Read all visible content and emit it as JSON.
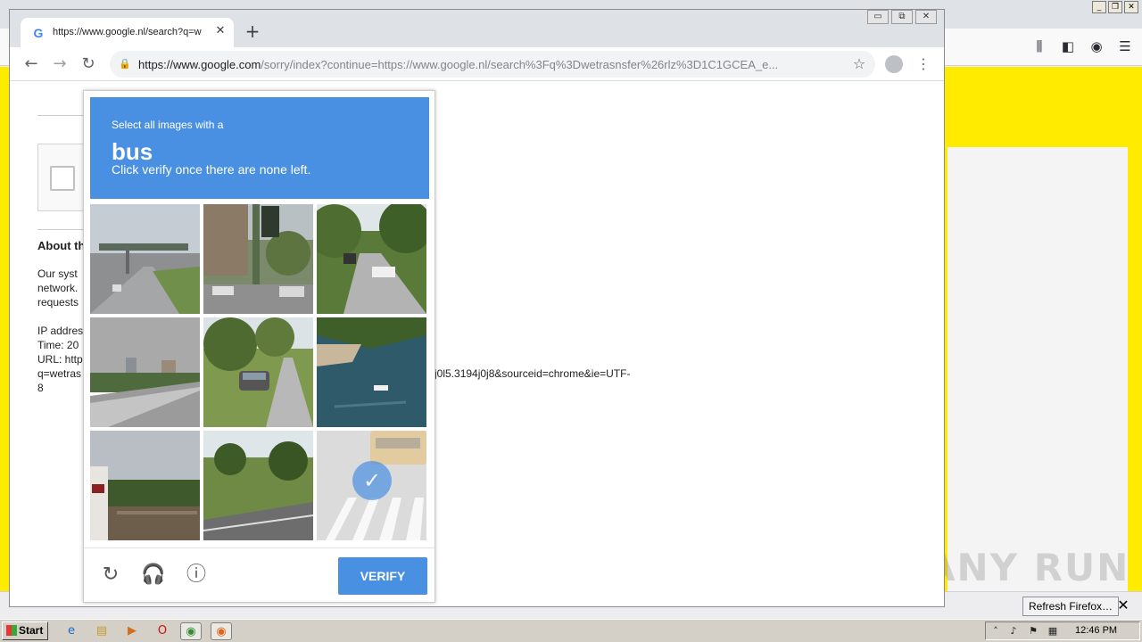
{
  "chrome": {
    "tab_title": "https://www.google.nl/search?q=w",
    "tab_close": "✕",
    "new_tab": "+",
    "url_host": "https://www.google.com",
    "url_rest": "/sorry/index?continue=https://www.google.nl/search%3Fq%3Dwetrasnsfer%26rlz%3D1C1GCEA_e...",
    "controls": {
      "minimize": "▭",
      "restore": "⧉",
      "close": "✕"
    }
  },
  "page": {
    "about_heading": "About th",
    "lines": [
      "Our syst",
      "network.",
      "requests",
      "IP addres",
      "Time: 20",
      "URL: http",
      "q=wetras",
      "8"
    ],
    "url_tail": "j0l5.3194j0j8&sourceid=chrome&ie=UTF-"
  },
  "captcha": {
    "instruction_pre": "Select all images with a",
    "target": "bus",
    "instruction_post": "Click verify once there are none left.",
    "verify_label": "VERIFY",
    "tiles": [
      {
        "scene": "highway-sign",
        "selected": false
      },
      {
        "scene": "traffic-light-parking",
        "selected": false
      },
      {
        "scene": "tree-road-cars",
        "selected": false
      },
      {
        "scene": "overpass-buildings",
        "selected": false
      },
      {
        "scene": "suburban-car-grass",
        "selected": false
      },
      {
        "scene": "river-boat",
        "selected": false
      },
      {
        "scene": "billboard-trees",
        "selected": false
      },
      {
        "scene": "road-trees",
        "selected": false
      },
      {
        "scene": "crosswalk-bus",
        "selected": true
      }
    ]
  },
  "firefox": {
    "refresh_label": "Refresh Firefox…",
    "watermark": "ANY RUN"
  },
  "taskbar": {
    "start_label": "Start",
    "clock": "12:46 PM"
  },
  "colors": {
    "captcha_blue": "#4a90e2",
    "firefox_yellow": "#ffeb00"
  }
}
